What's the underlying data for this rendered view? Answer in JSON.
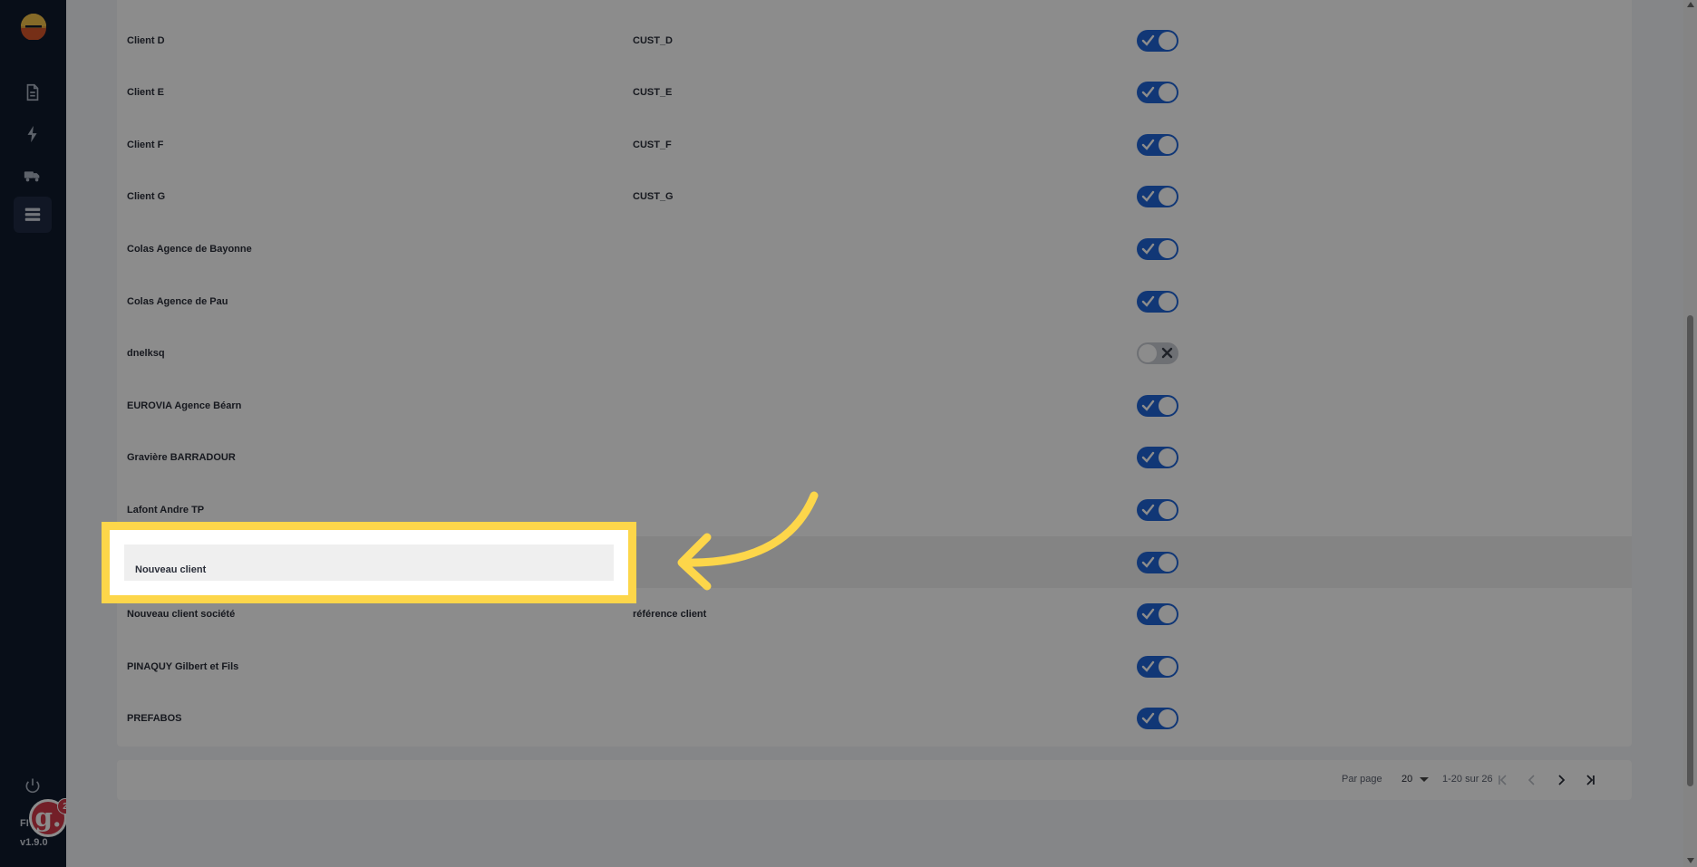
{
  "app": {
    "name": "FI",
    "version": "v1.9.0",
    "notification_count": "2",
    "assistant_letter": "g."
  },
  "sidebar": {
    "items": [
      {
        "name": "document-icon"
      },
      {
        "name": "lightning-icon"
      },
      {
        "name": "truck-icon"
      },
      {
        "name": "list-icon",
        "active": true
      }
    ]
  },
  "table": {
    "rows": [
      {
        "name": "Client D",
        "ref": "CUST_D",
        "active": true
      },
      {
        "name": "Client E",
        "ref": "CUST_E",
        "active": true
      },
      {
        "name": "Client F",
        "ref": "CUST_F",
        "active": true
      },
      {
        "name": "Client G",
        "ref": "CUST_G",
        "active": true
      },
      {
        "name": "Colas Agence de Bayonne",
        "ref": "",
        "active": true
      },
      {
        "name": "Colas Agence de Pau",
        "ref": "",
        "active": true
      },
      {
        "name": "dnelksq",
        "ref": "",
        "active": false
      },
      {
        "name": "EUROVIA Agence Béarn",
        "ref": "",
        "active": true
      },
      {
        "name": "Gravière BARRADOUR",
        "ref": "",
        "active": true
      },
      {
        "name": "Lafont Andre TP",
        "ref": "",
        "active": true
      },
      {
        "name": "Nouveau client",
        "ref": "",
        "active": true
      },
      {
        "name": "Nouveau client société",
        "ref": "référence client",
        "active": true
      },
      {
        "name": "PINAQUY Gilbert et Fils",
        "ref": "",
        "active": true
      },
      {
        "name": "PREFABOS",
        "ref": "",
        "active": true
      }
    ]
  },
  "pagination": {
    "per_page_label": "Par page",
    "per_page_value": "20",
    "range": "1-20 sur 26"
  },
  "highlight": {
    "label": "Nouveau client",
    "color": "#fdd64a"
  },
  "colors": {
    "sidebar": "#0f1a2c",
    "toggle_on": "#1f65d8",
    "toggle_off": "#c9ccd3"
  }
}
